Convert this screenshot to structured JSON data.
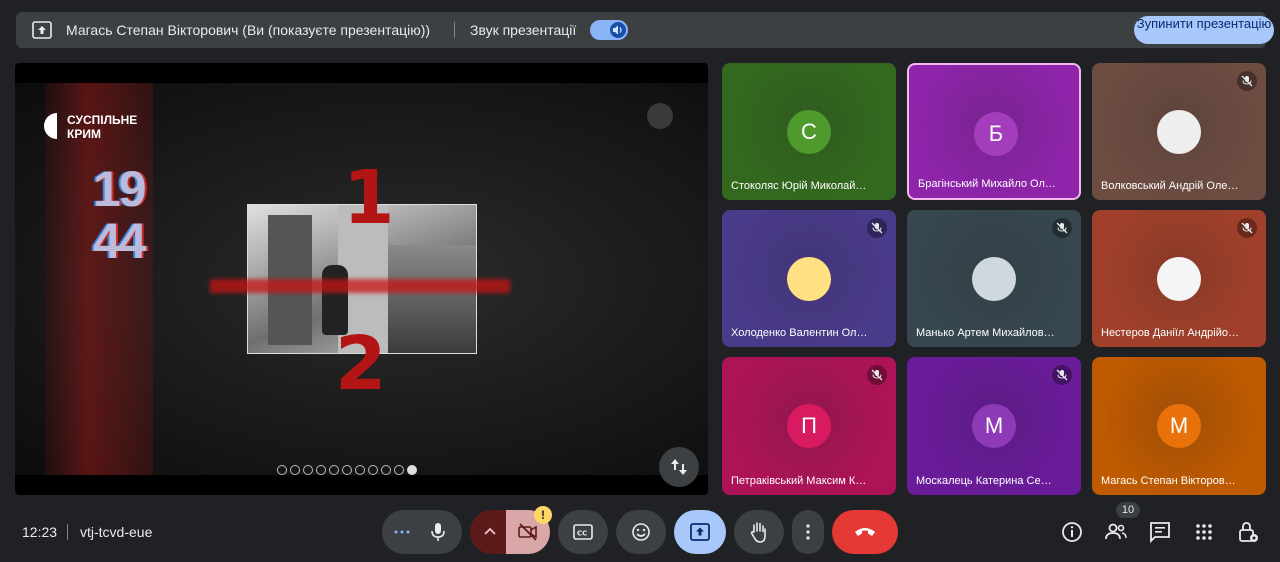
{
  "topbar": {
    "presenter": "Магась Степан Вікторович (Ви (показуєте презентацію))",
    "sound_label": "Звук презентації",
    "stop_button": "Зупинити презентацію"
  },
  "slide": {
    "logo_line1": "СУСПІЛЬНЕ",
    "logo_line2": "КРИМ",
    "year_top": "19",
    "year_bottom": "44",
    "number1": "1",
    "number2": "2",
    "dots_total": 11,
    "dots_active_index": 10
  },
  "participants": [
    {
      "initial": "С",
      "name": "Стоколяс Юрій Миколай…",
      "color": "#33691e",
      "avatar_color": "#4e9a2c",
      "muted": false
    },
    {
      "initial": "Б",
      "name": "Брагінський Михайло Ол…",
      "color": "#8e24aa",
      "avatar_color": "#a43dbb",
      "muted": false,
      "speaking": true
    },
    {
      "initial": "",
      "name": "Волковський Андрій Оле…",
      "color": "#6d4c41",
      "avatar_color": "#eee",
      "muted": true
    },
    {
      "initial": "",
      "name": "Холоденко Валентин Ол…",
      "color": "#4a3a8a",
      "avatar_color": "#ffe082",
      "muted": true
    },
    {
      "initial": "",
      "name": "Манько Артем Михайлов…",
      "color": "#37474f",
      "avatar_color": "#cfd8dc",
      "muted": true
    },
    {
      "initial": "",
      "name": "Нестеров Даніїл Андрійо…",
      "color": "#a1402a",
      "avatar_color": "#f5f5f5",
      "muted": true
    },
    {
      "initial": "П",
      "name": "Петраківський Максим К…",
      "color": "#ad1457",
      "avatar_color": "#d81b60",
      "muted": true
    },
    {
      "initial": "М",
      "name": "Москалець Катерина Се…",
      "color": "#6a1b9a",
      "avatar_color": "#8e3ab7",
      "muted": true
    },
    {
      "initial": "М",
      "name": "Магась Степан Вікторов…",
      "color": "#bf5a00",
      "avatar_color": "#e8710a",
      "muted": false
    }
  ],
  "bottom": {
    "time": "12:23",
    "meeting_code": "vtj-tcvd-eue",
    "participant_count": "10",
    "warning_mark": "!"
  },
  "colors": {
    "end_call": "#e53935",
    "present_active": "#a8c7fa",
    "speaking_border": "#f4b8f0"
  }
}
